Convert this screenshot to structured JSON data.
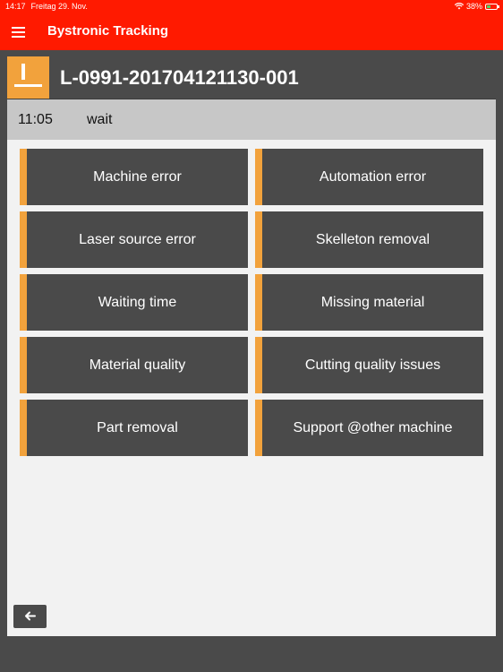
{
  "status_bar": {
    "time": "14:17",
    "date": "Freitag 29. Nov.",
    "battery": "38%",
    "wifi_icon": "wifi-icon",
    "battery_icon": "battery-icon"
  },
  "app_bar": {
    "title": "Bystronic Tracking",
    "menu_icon": "hamburger-menu-icon"
  },
  "job": {
    "id": "L-0991-201704121130-001",
    "icon": "alert-machine-icon",
    "time": "11:05",
    "state": "wait"
  },
  "reasons": [
    {
      "label": "Machine error"
    },
    {
      "label": "Automation error"
    },
    {
      "label": "Laser source error"
    },
    {
      "label": "Skelleton removal"
    },
    {
      "label": "Waiting time"
    },
    {
      "label": "Missing material"
    },
    {
      "label": "Material quality"
    },
    {
      "label": "Cutting quality issues"
    },
    {
      "label": "Part removal"
    },
    {
      "label": "Support @other machine"
    }
  ],
  "footer": {
    "back_icon": "arrow-left-icon"
  },
  "colors": {
    "brand_red": "#ff1a00",
    "accent_orange": "#f2a23c",
    "dark_gray": "#4a4a4a",
    "status_gray": "#c7c7c7",
    "content_bg": "#f2f2f2"
  }
}
